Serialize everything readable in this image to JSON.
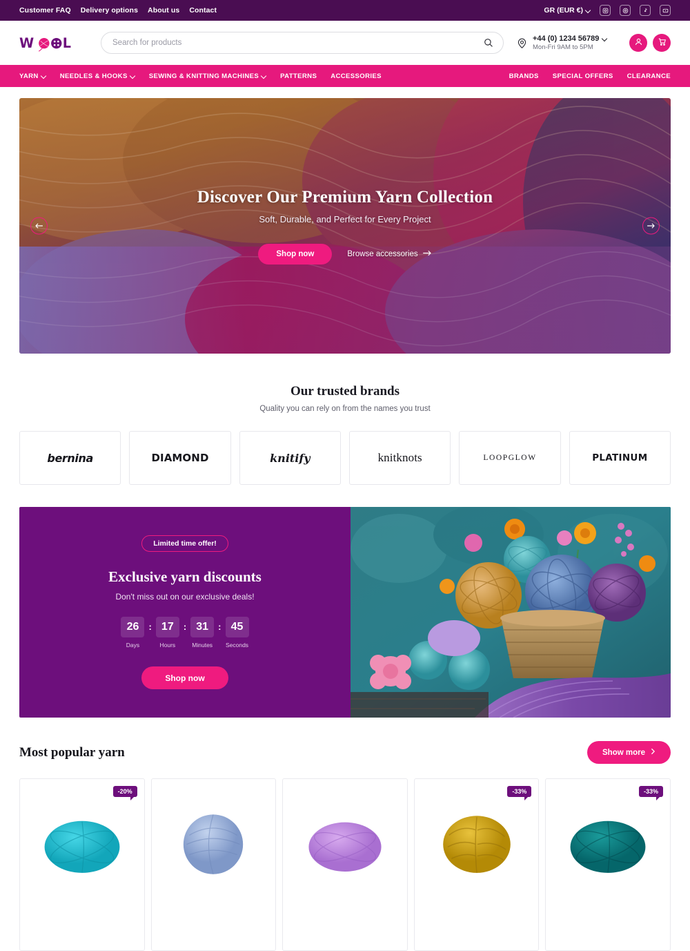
{
  "topbar": {
    "links": [
      {
        "label": "Customer FAQ"
      },
      {
        "label": "Delivery options"
      },
      {
        "label": "About us"
      },
      {
        "label": "Contact"
      }
    ],
    "currency": "GR (EUR €)",
    "social": [
      {
        "name": "instagram-icon"
      },
      {
        "name": "pinterest-icon"
      },
      {
        "name": "tiktok-icon"
      },
      {
        "name": "youtube-icon"
      }
    ]
  },
  "header": {
    "logo_text": "WOOL",
    "search_placeholder": "Search for products",
    "search_value": "",
    "phone": "+44 (0) 1234 56789",
    "hours": "Mon-Fri 9AM to 5PM"
  },
  "nav": {
    "left": [
      {
        "label": "YARN",
        "has_dropdown": true
      },
      {
        "label": "NEEDLES & HOOKS",
        "has_dropdown": true
      },
      {
        "label": "SEWING & KNITTING MACHINES",
        "has_dropdown": true
      },
      {
        "label": "PATTERNS",
        "has_dropdown": false
      },
      {
        "label": "ACCESSORIES",
        "has_dropdown": false
      }
    ],
    "right": [
      {
        "label": "BRANDS"
      },
      {
        "label": "SPECIAL OFFERS"
      },
      {
        "label": "CLEARANCE"
      }
    ]
  },
  "hero": {
    "title": "Discover Our Premium Yarn Collection",
    "subtitle": "Soft, Durable, and Perfect for Every Project",
    "primary_cta": "Shop now",
    "secondary_cta": "Browse accessories",
    "prev_label": "Previous slide",
    "next_label": "Next slide"
  },
  "brands": {
    "title": "Our trusted brands",
    "subtitle": "Quality you can rely on from the names you trust",
    "items": [
      {
        "label": "bernina"
      },
      {
        "label": "DIAMOND"
      },
      {
        "label": "knitify"
      },
      {
        "label": "knitknots"
      },
      {
        "label": "LOOPGLOW"
      },
      {
        "label": "PLATINUM"
      }
    ]
  },
  "promo": {
    "badge": "Limited time offer!",
    "title": "Exclusive yarn discounts",
    "description": "Don't miss out on our exclusive deals!",
    "cta": "Shop now",
    "countdown": [
      {
        "value": "26",
        "label": "Days"
      },
      {
        "value": "17",
        "label": "Hours"
      },
      {
        "value": "31",
        "label": "Minutes"
      },
      {
        "value": "45",
        "label": "Seconds"
      }
    ],
    "separator": ":"
  },
  "products": {
    "title": "Most popular yarn",
    "show_more": "Show more",
    "items": [
      {
        "discount": "-20%",
        "color": "#1fbdd0",
        "shade": "#17a3b6"
      },
      {
        "discount": "",
        "color": "#9db4dd",
        "shade": "#8299c6"
      },
      {
        "discount": "",
        "color": "#c08ce0",
        "shade": "#a872cb"
      },
      {
        "discount": "-33%",
        "color": "#d4a617",
        "shade": "#b88c0c"
      },
      {
        "discount": "-33%",
        "color": "#0e7a7a",
        "shade": "#086262"
      }
    ]
  },
  "colors": {
    "plum": "#4a0d52",
    "purple": "#6d0f7c",
    "pink": "#e6197d",
    "pink_bright": "#ef1b7f"
  }
}
